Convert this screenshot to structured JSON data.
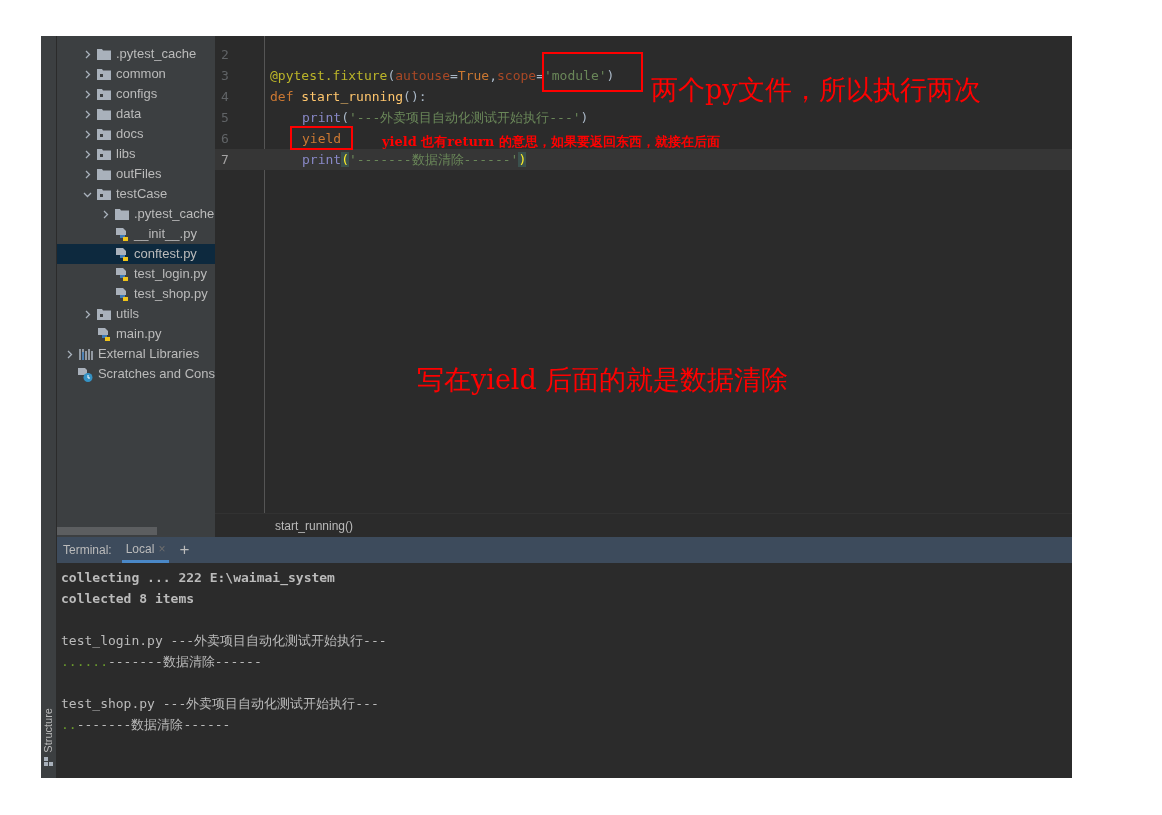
{
  "tool_strip": {
    "bottom_label": "Structure"
  },
  "project_tree": {
    "items": [
      {
        "name": ".pytest_cache",
        "kind": "folder",
        "expanded": false,
        "selected": false
      },
      {
        "name": "common",
        "kind": "package",
        "expanded": false,
        "selected": false
      },
      {
        "name": "configs",
        "kind": "package",
        "expanded": false,
        "selected": false
      },
      {
        "name": "data",
        "kind": "folder",
        "expanded": false,
        "selected": false
      },
      {
        "name": "docs",
        "kind": "package",
        "expanded": false,
        "selected": false
      },
      {
        "name": "libs",
        "kind": "package",
        "expanded": false,
        "selected": false
      },
      {
        "name": "outFiles",
        "kind": "folder",
        "expanded": false,
        "selected": false
      },
      {
        "name": "testCase",
        "kind": "package",
        "expanded": true,
        "selected": false,
        "children": [
          {
            "name": ".pytest_cache",
            "kind": "folder",
            "expanded": false,
            "selected": false
          },
          {
            "name": "__init__.py",
            "kind": "python",
            "selected": false
          },
          {
            "name": "conftest.py",
            "kind": "python",
            "selected": true
          },
          {
            "name": "test_login.py",
            "kind": "python",
            "selected": false
          },
          {
            "name": "test_shop.py",
            "kind": "python",
            "selected": false
          }
        ]
      },
      {
        "name": "utils",
        "kind": "package",
        "expanded": false,
        "selected": false
      },
      {
        "name": "main.py",
        "kind": "python",
        "selected": false
      }
    ],
    "other_items": [
      {
        "name": "External Libraries",
        "kind": "library",
        "expanded": false,
        "selected": false
      },
      {
        "name": "Scratches and Cons",
        "kind": "scratches",
        "selected": false
      }
    ]
  },
  "editor": {
    "lines": [
      {
        "number": "2",
        "current": false
      },
      {
        "number": "3",
        "current": false,
        "tokens": [
          {
            "text": "@pytest.fixture",
            "kind": "decorator"
          },
          {
            "text": "(",
            "kind": "plain"
          },
          {
            "text": "autouse",
            "kind": "param"
          },
          {
            "text": "=",
            "kind": "plain"
          },
          {
            "text": "True",
            "kind": "keyword"
          },
          {
            "text": ",",
            "kind": "plain"
          },
          {
            "text": "scope",
            "kind": "param"
          },
          {
            "text": "=",
            "kind": "plain"
          },
          {
            "text": "'module'",
            "kind": "string"
          },
          {
            "text": ")",
            "kind": "plain"
          }
        ]
      },
      {
        "number": "4",
        "current": false,
        "tokens": [
          {
            "text": "def",
            "kind": "keyword"
          },
          {
            "text": " start_running",
            "kind": "function"
          },
          {
            "text": "():",
            "kind": "plain"
          }
        ],
        "children": [
          {
            "number": "5",
            "current": false,
            "tokens": [
              {
                "text": "print",
                "kind": "builtin"
              },
              {
                "text": "(",
                "kind": "plain"
              },
              {
                "text": "'---外卖项目自动化测试开始执行---'",
                "kind": "string"
              },
              {
                "text": ")",
                "kind": "plain"
              }
            ]
          },
          {
            "number": "6",
            "current": false,
            "tokens": [
              {
                "text": "yield",
                "kind": "keyword"
              }
            ]
          },
          {
            "number": "7",
            "current": true,
            "tokens": [
              {
                "text": "print",
                "kind": "builtin"
              },
              {
                "text": "(",
                "kind": "match"
              },
              {
                "text": "'-------数据清除------'",
                "kind": "string"
              },
              {
                "text": ")",
                "kind": "match"
              }
            ]
          }
        ]
      }
    ],
    "breadcrumb": "start_running()"
  },
  "annotations": [
    {
      "text": "两个py文件，所以执行两次",
      "kind": "large"
    },
    {
      "text": "yield 也有return 的意思，如果要返回东西，就接在后面",
      "kind": "small"
    },
    {
      "text": "写在yield 后面的就是数据清除",
      "kind": "large"
    }
  ],
  "terminal": {
    "label": "Terminal:",
    "tabs": [
      {
        "label": "Local",
        "selected": true,
        "close": "×"
      }
    ],
    "add": "+",
    "blocks": [
      [
        {
          "segments": [
            {
              "text": "collecting ... 222 E:\\waimai_system",
              "kind": "bold"
            }
          ]
        },
        {
          "segments": [
            {
              "text": "collected 8 items",
              "kind": "bold"
            }
          ]
        }
      ],
      [
        {
          "segments": [
            {
              "text": "test_login.py ---外卖项目自动化测试开始执行---",
              "kind": "plain"
            }
          ]
        },
        {
          "segments": [
            {
              "text": "......",
              "kind": "pass"
            },
            {
              "text": "-------数据清除------",
              "kind": "plain"
            }
          ]
        }
      ],
      [
        {
          "segments": [
            {
              "text": "test_shop.py ---外卖项目自动化测试开始执行---",
              "kind": "plain"
            }
          ]
        },
        {
          "segments": [
            {
              "text": "..",
              "kind": "pass"
            },
            {
              "text": "-------数据清除------",
              "kind": "plain"
            }
          ]
        }
      ]
    ]
  }
}
